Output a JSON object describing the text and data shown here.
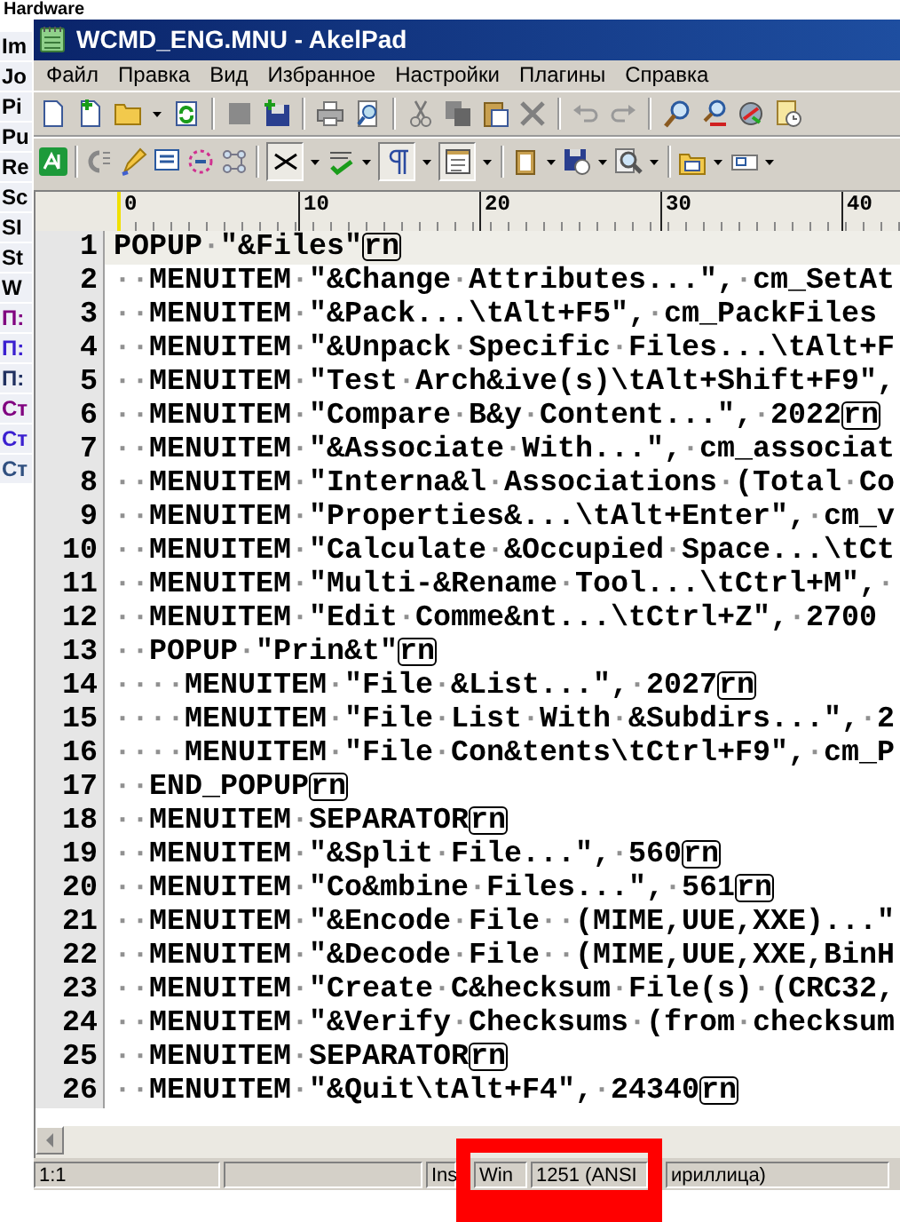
{
  "background_window": {
    "heading": "Hardware",
    "items": [
      {
        "text": "Im",
        "color": "#000000"
      },
      {
        "text": "Jo",
        "color": "#000000"
      },
      {
        "text": "Pi",
        "color": "#000000"
      },
      {
        "text": "Pu",
        "color": "#000000"
      },
      {
        "text": "Re",
        "color": "#000000"
      },
      {
        "text": "Sc",
        "color": "#000000"
      },
      {
        "text": "SI",
        "color": "#000000"
      },
      {
        "text": "St",
        "color": "#000000"
      },
      {
        "text": "W",
        "color": "#000000"
      },
      {
        "text": "П:",
        "color": "#800080"
      },
      {
        "text": "П:",
        "color": "#3a1fd0"
      },
      {
        "text": "П:",
        "color": "#203060"
      },
      {
        "text": "Ст",
        "color": "#800080"
      },
      {
        "text": "Ст",
        "color": "#3a1fd0"
      },
      {
        "text": "Ст",
        "color": "#305080"
      }
    ]
  },
  "window": {
    "title": "WCMD_ENG.MNU - AkelPad"
  },
  "menu": [
    "Файл",
    "Правка",
    "Вид",
    "Избранное",
    "Настройки",
    "Плагины",
    "Справка"
  ],
  "toolbar_2_toggles": [
    {
      "pressed": true
    },
    {
      "pressed": true
    },
    {
      "pressed": true
    }
  ],
  "ruler": {
    "marks": [
      "0",
      "10",
      "20",
      "30",
      "40"
    ]
  },
  "editor": {
    "lines": [
      {
        "number": "1",
        "text": "POPUP·\"&Files\"",
        "eol": "rn",
        "current": true
      },
      {
        "number": "2",
        "text": "··MENUITEM·\"&Change·Attributes...\",·cm_SetAt",
        "current": false
      },
      {
        "number": "3",
        "text": "··MENUITEM·\"&Pack...\\tAlt+F5\",·cm_PackFiles",
        "current": false
      },
      {
        "number": "4",
        "text": "··MENUITEM·\"&Unpack·Specific·Files...\\tAlt+F",
        "current": false
      },
      {
        "number": "5",
        "text": "··MENUITEM·\"Test·Arch&ive(s)\\tAlt+Shift+F9\",",
        "current": false
      },
      {
        "number": "6",
        "text": "··MENUITEM·\"Compare·B&y·Content...\",·2022",
        "eol": "rn",
        "current": false
      },
      {
        "number": "7",
        "text": "··MENUITEM·\"&Associate·With...\",·cm_associat",
        "current": false
      },
      {
        "number": "8",
        "text": "··MENUITEM·\"Interna&l·Associations·(Total·Co",
        "current": false
      },
      {
        "number": "9",
        "text": "··MENUITEM·\"Properties&...\\tAlt+Enter\",·cm_v",
        "current": false
      },
      {
        "number": "10",
        "text": "··MENUITEM·\"Calculate·&Occupied·Space...\\tCt",
        "current": false
      },
      {
        "number": "11",
        "text": "··MENUITEM·\"Multi-&Rename·Tool...\\tCtrl+M\",·",
        "current": false
      },
      {
        "number": "12",
        "text": "··MENUITEM·\"Edit·Comme&nt...\\tCtrl+Z\",·2700",
        "current": false
      },
      {
        "number": "13",
        "text": "··POPUP·\"Prin&t\"",
        "eol": "rn",
        "current": false
      },
      {
        "number": "14",
        "text": "····MENUITEM·\"File·&List...\",·2027",
        "eol": "rn",
        "current": false
      },
      {
        "number": "15",
        "text": "····MENUITEM·\"File·List·With·&Subdirs...\",·2",
        "current": false
      },
      {
        "number": "16",
        "text": "····MENUITEM·\"File·Con&tents\\tCtrl+F9\",·cm_P",
        "current": false
      },
      {
        "number": "17",
        "text": "··END_POPUP",
        "eol": "rn",
        "current": false
      },
      {
        "number": "18",
        "text": "··MENUITEM·SEPARATOR",
        "eol": "rn",
        "current": false
      },
      {
        "number": "19",
        "text": "··MENUITEM·\"&Split·File...\",·560",
        "eol": "rn",
        "current": false
      },
      {
        "number": "20",
        "text": "··MENUITEM·\"Co&mbine·Files...\",·561",
        "eol": "rn",
        "current": false
      },
      {
        "number": "21",
        "text": "··MENUITEM·\"&Encode·File··(MIME,UUE,XXE)...\"",
        "current": false
      },
      {
        "number": "22",
        "text": "··MENUITEM·\"&Decode·File··(MIME,UUE,XXE,BinH",
        "current": false
      },
      {
        "number": "23",
        "text": "··MENUITEM·\"Create·C&hecksum·File(s)·(CRC32,",
        "current": false
      },
      {
        "number": "24",
        "text": "··MENUITEM·\"&Verify·Checksums·(from·checksum",
        "current": false
      },
      {
        "number": "25",
        "text": "··MENUITEM·SEPARATOR",
        "eol": "rn",
        "current": false
      },
      {
        "number": "26",
        "text": "··MENUITEM·\"&Quit\\tAlt+F4\",·24340",
        "eol": "rn",
        "current": false
      }
    ]
  },
  "status_bar": {
    "position": "1:1",
    "mode": "Ins",
    "codepage_type": "Win",
    "codepage": "1251 (ANSI",
    "codepage_name": "ириллица)"
  }
}
